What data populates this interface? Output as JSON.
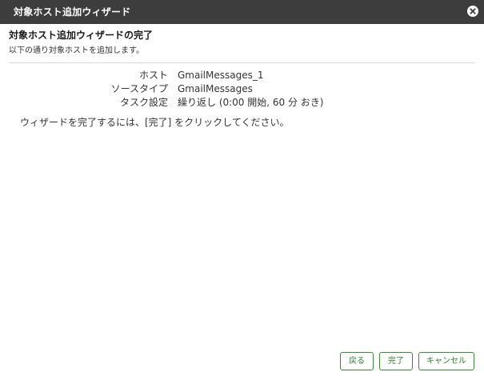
{
  "window": {
    "title": "対象ホスト追加ウィザード",
    "close_icon": "close-icon"
  },
  "content": {
    "heading": "対象ホスト追加ウィザードの完了",
    "subtitle": "以下の通り対象ホストを追加します。",
    "summary": [
      {
        "label": "ホスト",
        "value": "GmailMessages_1"
      },
      {
        "label": "ソースタイプ",
        "value": "GmailMessages"
      },
      {
        "label": "タスク設定",
        "value": "繰り返し (0:00 開始, 60 分 おき)"
      }
    ],
    "instruction": "ウィザードを完了するには、[完了] をクリックしてください。"
  },
  "footer": {
    "back_label": "戻る",
    "finish_label": "完了",
    "cancel_label": "キャンセル"
  },
  "colors": {
    "titlebar": "#3d3d3d",
    "button_border": "#3a8a3a",
    "button_text": "#2e7d2e"
  }
}
